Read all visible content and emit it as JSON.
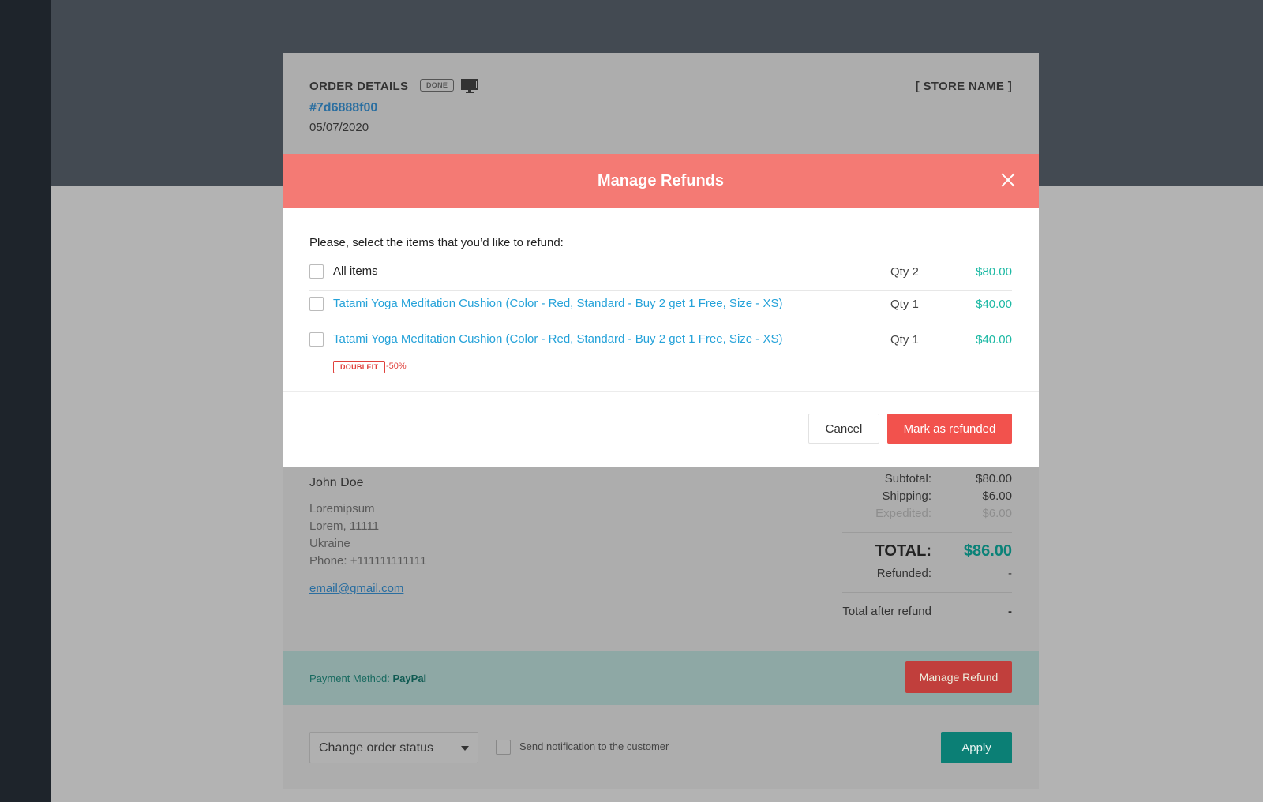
{
  "order": {
    "title": "ORDER DETAILS",
    "status_badge": "DONE",
    "device_icon": "monitor-icon",
    "order_id": "#7d6888f00",
    "date": "05/07/2020",
    "store_name": "[ STORE NAME ]"
  },
  "customer": {
    "name": "John Doe",
    "address_lines": [
      "Loremipsum",
      "Lorem, 11111",
      "Ukraine",
      "Phone: +111111111111"
    ],
    "email": "email@gmail.com"
  },
  "summary": {
    "subtotal_label": "Subtotal:",
    "subtotal": "$80.00",
    "shipping_label": "Shipping:",
    "shipping": "$6.00",
    "expedited_label": "Expedited:",
    "expedited": "$6.00",
    "total_label": "TOTAL:",
    "total": "$86.00",
    "refunded_label": "Refunded:",
    "refunded": "-",
    "after_refund_label": "Total after refund",
    "after_refund": "-"
  },
  "payment": {
    "label": "Payment Method:",
    "method": "PayPal",
    "manage_refund_label": "Manage Refund"
  },
  "footer": {
    "status_select_value": "Change order status",
    "notify_label": "Send notification to the customer",
    "notify_checked": false,
    "apply_label": "Apply"
  },
  "modal": {
    "title": "Manage Refunds",
    "intro": "Please, select the items that you’d like to refund:",
    "all_items": {
      "label": "All items",
      "qty": "Qty 2",
      "price": "$80.00",
      "checked": false
    },
    "items": [
      {
        "name": "Tatami Yoga Meditation Cushion (Color - Red, Standard - Buy 2 get 1 Free, Size - XS)",
        "qty": "Qty 1",
        "price": "$40.00",
        "checked": false
      },
      {
        "name": "Tatami Yoga Meditation Cushion (Color - Red, Standard - Buy 2 get 1 Free, Size - XS)",
        "qty": "Qty 1",
        "price": "$40.00",
        "checked": false,
        "coupon": "DOUBLEIT",
        "discount": "-50%"
      }
    ],
    "cancel_label": "Cancel",
    "confirm_label": "Mark as refunded"
  },
  "colors": {
    "modal_header": "#f47a74",
    "primary_red": "#f2524d",
    "price_teal": "#1cb9a4",
    "link_blue": "#25a2d9",
    "apply_teal": "#0b7f75"
  }
}
